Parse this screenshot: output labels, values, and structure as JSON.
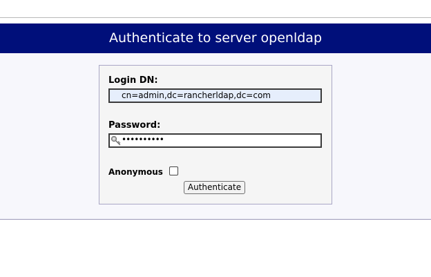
{
  "header": {
    "title": "Authenticate to server openldap"
  },
  "login_form": {
    "login_dn_label": "Login DN:",
    "login_dn_value": "cn=admin,dc=rancherldap,dc=com",
    "password_label": "Password:",
    "password_value": "••••••••••",
    "anonymous_label": "Anonymous",
    "anonymous_checked": false,
    "submit_label": "Authenticate"
  },
  "icons": {
    "password_field_icon": "key-icon"
  },
  "colors": {
    "title_bar": "#000f7a",
    "title_text": "#ffffff",
    "login_field_background": "#e6eefc",
    "content_background": "#f7f7fc"
  }
}
